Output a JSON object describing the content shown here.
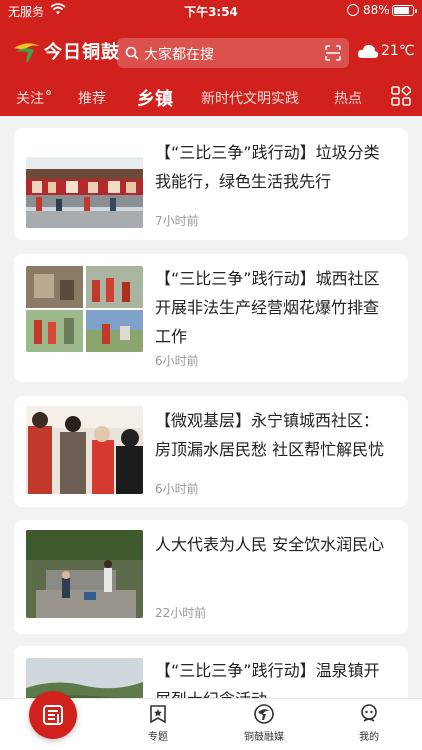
{
  "status_bar": {
    "carrier": "无服务",
    "time": "下午3:54",
    "battery": "88%",
    "battery_level": 0.88
  },
  "app": {
    "name": "今日铜鼓",
    "search_placeholder": "大家都在搜",
    "weather_temp": "21℃",
    "brand_color": "#d0211c"
  },
  "tabs": [
    {
      "label": "关注",
      "has_dot": true
    },
    {
      "label": "推荐"
    },
    {
      "label": "乡镇",
      "active": true
    },
    {
      "label": "新时代文明实践"
    },
    {
      "label": "热点"
    }
  ],
  "articles": [
    {
      "title": "【“三比三争”践行动】垃圾分类我能行，绿色生活我先行",
      "time": "7小时前"
    },
    {
      "title": "【“三比三争”践行动】城西社区开展非法生产经营烟花爆竹排查工作",
      "time": "6小时前"
    },
    {
      "title": "【微观基层】永宁镇城西社区：房顶漏水居民愁 社区帮忙解民忧",
      "time": "6小时前"
    },
    {
      "title": "人大代表为人民 安全饮水润民心",
      "time": "22小时前"
    },
    {
      "title": "【“三比三争”践行动】温泉镇开展烈士纪念活动",
      "time": ""
    }
  ],
  "bottom_nav": [
    {
      "label": "",
      "icon": "news-icon"
    },
    {
      "label": "专题",
      "icon": "topic-icon"
    },
    {
      "label": "铜鼓融媒",
      "icon": "media-icon"
    },
    {
      "label": "我的",
      "icon": "profile-icon"
    }
  ]
}
